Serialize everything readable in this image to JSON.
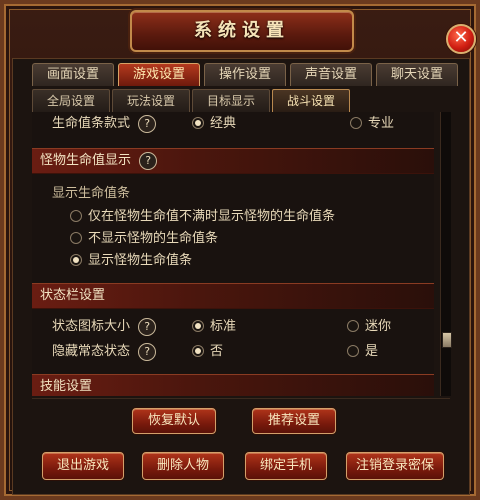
{
  "window": {
    "title": "系统设置",
    "close_glyph": "✕"
  },
  "tabs": {
    "main": [
      "画面设置",
      "游戏设置",
      "操作设置",
      "声音设置",
      "聊天设置"
    ],
    "sub": [
      "全局设置",
      "玩法设置",
      "目标显示",
      "战斗设置"
    ]
  },
  "content": {
    "hp_style": {
      "label": "生命值条款式",
      "help": "?",
      "options": [
        "经典",
        "专业"
      ],
      "selected": "经典"
    },
    "monster_section": {
      "title": "怪物生命值显示",
      "help": "?"
    },
    "monster_display": {
      "label": "显示生命值条",
      "options": [
        "仅在怪物生命值不满时显示怪物的生命值条",
        "不显示怪物的生命值条",
        "显示怪物生命值条"
      ],
      "selected": "显示怪物生命值条"
    },
    "status_section": {
      "title": "状态栏设置"
    },
    "status_icon_size": {
      "label": "状态图标大小",
      "help": "?",
      "options": [
        "标准",
        "迷你"
      ],
      "selected": "标准"
    },
    "hide_status": {
      "label": "隐藏常态状态",
      "help": "?",
      "options": [
        "否",
        "是"
      ],
      "selected": "否"
    },
    "skill_section": {
      "title": "技能设置"
    }
  },
  "buttons": {
    "restore_default": "恢复默认",
    "recommended": "推荐设置",
    "exit_game": "退出游戏",
    "delete_character": "删除人物",
    "bind_phone": "绑定手机",
    "cancel_login_password": "注销登录密保"
  },
  "colors": {
    "accent": "#b0341a",
    "text": "#e8d9b9",
    "section": "#6a1d12"
  }
}
